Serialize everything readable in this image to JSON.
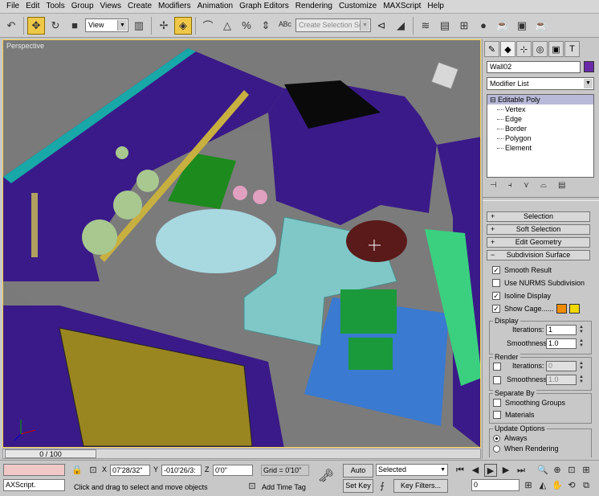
{
  "menu": [
    "File",
    "Edit",
    "Tools",
    "Group",
    "Views",
    "Create",
    "Modifiers",
    "Animation",
    "Graph Editors",
    "Rendering",
    "Customize",
    "MAXScript",
    "Help"
  ],
  "toolbar": {
    "refcoord": "View",
    "selection_set_placeholder": "Create Selection Set",
    "icons": [
      "undo-icon",
      "move-icon",
      "rotate-icon",
      "scale-icon",
      "view-icon",
      "select-icon",
      "snap-icon",
      "angle-snap-icon",
      "percent-snap-icon",
      "spinner-snap-icon",
      "mirror-icon",
      "align-icon",
      "layer-icon",
      "curve-editor-icon",
      "schematic-icon",
      "material-editor-icon",
      "render-scene-icon",
      "quick-render-icon"
    ]
  },
  "viewport": {
    "label": "Perspective"
  },
  "command_panel": {
    "object_name": "Wall02",
    "object_color": "#6a2aa8",
    "modifier_list": "Modifier List",
    "stack": {
      "base": "Editable Poly",
      "sub_objects": [
        "Vertex",
        "Edge",
        "Border",
        "Polygon",
        "Element"
      ]
    },
    "rollouts": {
      "selection": "Selection",
      "soft_selection": "Soft Selection",
      "edit_geometry": "Edit Geometry",
      "subdivision_surface": "Subdivision Surface"
    },
    "subdivision": {
      "smooth_result": "Smooth Result",
      "use_nurms": "Use NURMS Subdivision",
      "isoline_display": "Isoline Display",
      "show_cage": "Show Cage......",
      "cage_color_1": "#f08c00",
      "cage_color_2": "#f0d800",
      "display_group": "Display",
      "render_group": "Render",
      "iterations_label": "Iterations:",
      "smoothness_label": "Smoothness:",
      "display_iterations": "1",
      "display_smoothness": "1.0",
      "render_iterations": "0",
      "render_smoothness": "1.0",
      "separate_by_group": "Separate By",
      "smoothing_groups": "Smoothing Groups",
      "materials": "Materials",
      "update_options_group": "Update Options",
      "always": "Always",
      "when_rendering": "When Rendering"
    }
  },
  "timeslider": {
    "position": "0 / 100"
  },
  "statusbar": {
    "maxscript": "AXScript.",
    "x_label": "X",
    "y_label": "Y",
    "z_label": "Z",
    "x_value": "07'28/32\"",
    "y_value": "-010'26/3:",
    "z_value": "0'0\"",
    "grid": "Grid = 0'10\"",
    "prompt": "Click and drag to select and move objects",
    "add_time_tag": "Add Time Tag",
    "auto_key": "Auto Key",
    "set_key": "Set Key",
    "key_mode": "Selected",
    "key_filters": "Key Filters...",
    "frame": "0"
  }
}
